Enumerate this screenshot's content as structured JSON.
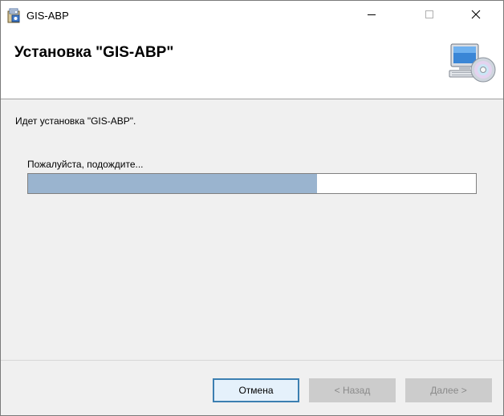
{
  "window": {
    "title": "GIS-ABP",
    "icons": {
      "app": "installer-package-icon",
      "minimize": "minimize-icon",
      "maximize": "maximize-icon",
      "close": "close-icon"
    }
  },
  "header": {
    "title": "Установка \"GIS-ABP\"",
    "icon": "computer-cd-icon"
  },
  "body": {
    "status": "Идет установка \"GIS-ABP\".",
    "wait": "Пожалуйста, подождите...",
    "progress_fraction": 0.645
  },
  "buttons": {
    "cancel": "Отмена",
    "back": "< Назад",
    "next": "Далее >"
  },
  "colors": {
    "progress_fill": "#9ab4cf",
    "default_button_border": "#3c7fb1"
  }
}
